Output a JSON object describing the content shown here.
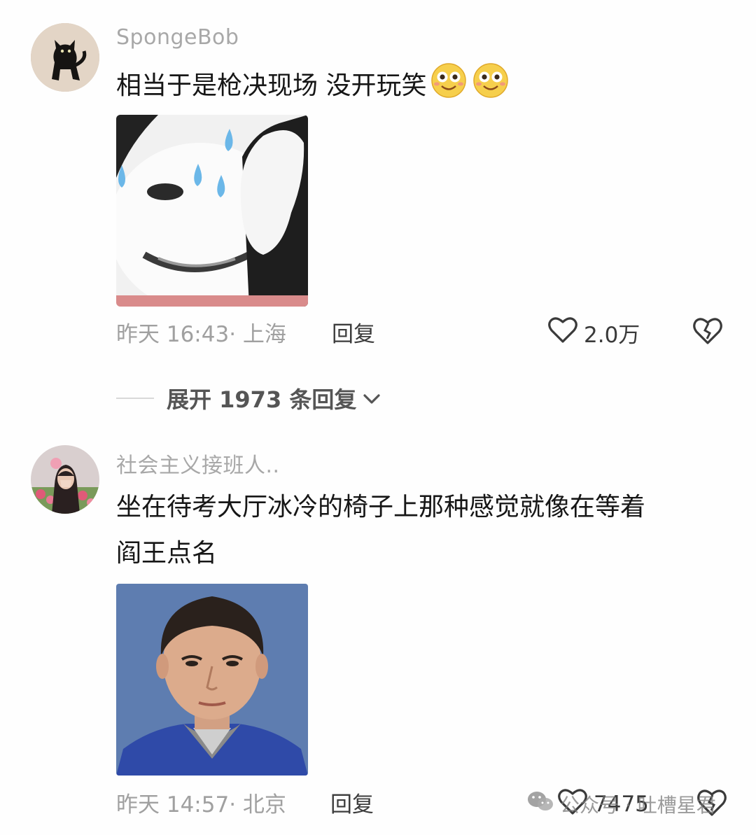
{
  "comments": [
    {
      "username": "SpongeBob",
      "text": "相当于是枪决现场 没开玩笑",
      "emoji_icon": "smiling-face-emoji",
      "media_image": "sweating-panda-meme",
      "time_location": "昨天 16:43· 上海",
      "reply_label": "回复",
      "likes": "2.0万"
    },
    {
      "username": "社会主义接班人..",
      "text_line1": "坐在待考大厅冰冷的椅子上那种感觉就像在等着",
      "text_line2": "阎王点名",
      "media_image": "id-photo-portrait",
      "time_location": "昨天 14:57· 北京",
      "reply_label": "回复",
      "likes": "7475"
    }
  ],
  "expand_replies": {
    "label": "展开 1973 条回复"
  },
  "watermark": {
    "text": "公众号 · 吐槽星君"
  },
  "colors": {
    "background": "#fefefe",
    "username": "#a8a8a8",
    "meta": "#a0a0a0",
    "text": "#161616"
  }
}
